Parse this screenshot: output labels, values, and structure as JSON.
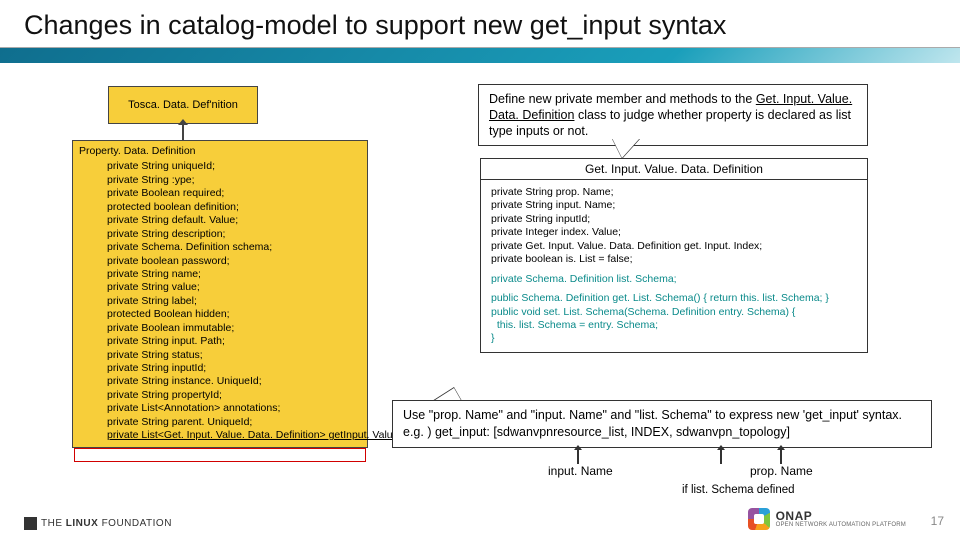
{
  "title": "Changes in catalog-model to support new get_input syntax",
  "tosca_box": "Tosca. Data. Def'nition",
  "prop_def": {
    "head": "Property. Data. Definition",
    "lines": [
      "private String uniqueId;",
      "private String :ype;",
      "private Boolean required;",
      "protected boolean definition;",
      "private String default. Value;",
      "private String description;",
      "private Schema. Definition schema;",
      "private boolean password;",
      "private String name;",
      "private String value;",
      "private String label;",
      "protected Boolean hidden;",
      "private Boolean immutable;",
      "private String input. Path;",
      "private String status;",
      "private String inputId;",
      "private String instance. UniqueId;",
      "private String propertyId;",
      "private List<Annotation> annotations;",
      "private String parent. UniqueId;"
    ],
    "highlight": "private List<Get. Input. Value. Data. Definition> getInput. Values;"
  },
  "callout1": {
    "pre": "Define new private member and methods to the ",
    "u": "Get. Input. Value. Data. Definition",
    "post": " class to judge whether property is declared as list type inputs or not."
  },
  "code": {
    "header": "Get. Input. Value. Data. Definition",
    "black": [
      "private String prop. Name;",
      "private String input. Name;",
      "private String inputId;",
      "private Integer index. Value;",
      "private Get. Input. Value. Data. Definition get. Input. Index;",
      "private boolean is. List = false;"
    ],
    "teal1": "private Schema. Definition list. Schema;",
    "teal_block": [
      "public Schema. Definition get. List. Schema() { return this. list. Schema; }",
      "public void set. List. Schema(Schema. Definition entry. Schema) {",
      "  this. list. Schema = entry. Schema;",
      "}"
    ]
  },
  "callout2": {
    "l1": "Use \"prop. Name\" and \"input. Name\" and \"list. Schema\" to express new 'get_input' syntax.",
    "l2": "e.g. ) get_input:  [sdwanvpnresource_list, INDEX, sdwanvpn_topology]"
  },
  "sub": {
    "input": "input. Name",
    "prop": "prop. Name",
    "cond": "if list. Schema defined"
  },
  "footer": {
    "linux_pre": "THE",
    "linux_b": "LINUX",
    "linux_post": "FOUNDATION",
    "onap": "ONAP",
    "onap_sub": "OPEN NETWORK AUTOMATION PLATFORM"
  },
  "page": "17"
}
